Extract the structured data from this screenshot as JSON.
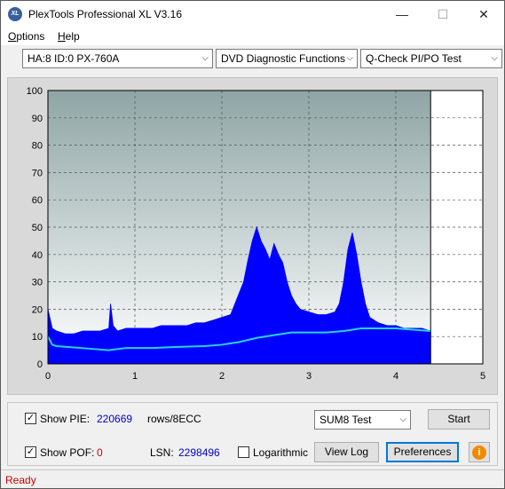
{
  "window": {
    "title": "PlexTools Professional XL V3.16",
    "icon_text": "XL",
    "controls": {
      "minimize": "—",
      "maximize": "☐",
      "close": "✕"
    }
  },
  "menu": {
    "items": [
      {
        "label": "Options",
        "underline": "O",
        "rest": "ptions"
      },
      {
        "label": "Help",
        "underline": "H",
        "rest": "elp"
      }
    ]
  },
  "toolbar": {
    "drive": "HA:8 ID:0  PX-760A",
    "function": "DVD Diagnostic Functions",
    "test": "Q-Check PI/PO Test"
  },
  "chart_data": {
    "type": "line",
    "title": "",
    "xlabel": "",
    "ylabel": "",
    "xlim": [
      0,
      5
    ],
    "ylim": [
      0,
      100
    ],
    "x_ticks": [
      "0",
      "1",
      "2",
      "3",
      "4",
      "5"
    ],
    "y_ticks": [
      "0",
      "10",
      "20",
      "30",
      "40",
      "50",
      "60",
      "70",
      "80",
      "90",
      "100"
    ],
    "grid": true,
    "end_marker_x": 4.4,
    "colors": {
      "pie": "#0000ff",
      "sum8": "#26d3e6",
      "background": "#8fa8a8"
    },
    "series": [
      {
        "kind": "area",
        "color": "#0000ff",
        "x": [
          0,
          0.05,
          0.1,
          0.2,
          0.3,
          0.4,
          0.5,
          0.6,
          0.7,
          0.72,
          0.75,
          0.8,
          0.9,
          1.0,
          1.1,
          1.2,
          1.3,
          1.4,
          1.5,
          1.6,
          1.7,
          1.8,
          1.9,
          2.0,
          2.1,
          2.15,
          2.2,
          2.25,
          2.3,
          2.35,
          2.4,
          2.45,
          2.5,
          2.55,
          2.6,
          2.65,
          2.7,
          2.75,
          2.8,
          2.85,
          2.9,
          3.0,
          3.1,
          3.2,
          3.3,
          3.35,
          3.4,
          3.45,
          3.5,
          3.55,
          3.6,
          3.65,
          3.7,
          3.8,
          3.9,
          4.0,
          4.1,
          4.2,
          4.3,
          4.4
        ],
        "values": [
          20,
          13,
          12,
          11,
          11,
          12,
          12,
          12,
          13,
          22,
          14,
          12,
          13,
          13,
          13,
          13,
          14,
          14,
          14,
          14,
          15,
          15,
          16,
          17,
          18,
          22,
          26,
          30,
          38,
          45,
          50,
          45,
          42,
          38,
          44,
          40,
          37,
          30,
          25,
          22,
          20,
          19,
          18,
          18,
          19,
          22,
          30,
          42,
          48,
          40,
          30,
          22,
          17,
          15,
          14,
          14,
          13,
          13,
          13,
          12
        ]
      },
      {
        "kind": "line",
        "color": "#26d3e6",
        "x": [
          0,
          0.05,
          0.1,
          0.3,
          0.5,
          0.7,
          0.9,
          1.2,
          1.5,
          1.8,
          2.0,
          2.2,
          2.4,
          2.6,
          2.8,
          3.0,
          3.2,
          3.4,
          3.6,
          3.8,
          4.0,
          4.2,
          4.4
        ],
        "values": [
          10,
          7,
          6.5,
          6,
          5.5,
          5,
          5.8,
          5.8,
          6.2,
          6.5,
          7,
          8,
          9.5,
          10.5,
          11.5,
          11.5,
          11.5,
          12,
          13,
          13,
          13,
          12.5,
          12
        ]
      }
    ]
  },
  "controls": {
    "show_pie_label": "Show PIE:",
    "show_pie_checked": "✓",
    "pie_value": "220669",
    "pie_unit": "rows/8ECC",
    "show_pof_label": "Show POF:",
    "show_pof_checked": "✓",
    "pof_value": "0",
    "lsn_label": "LSN:",
    "lsn_value": "2298496",
    "logarithmic_label": "Logarithmic",
    "test_select": "SUM8 Test",
    "start_button": "Start",
    "view_log_button": "View Log",
    "preferences_button": "Preferences",
    "info_icon": "info-icon"
  },
  "status": {
    "text": "Ready"
  }
}
